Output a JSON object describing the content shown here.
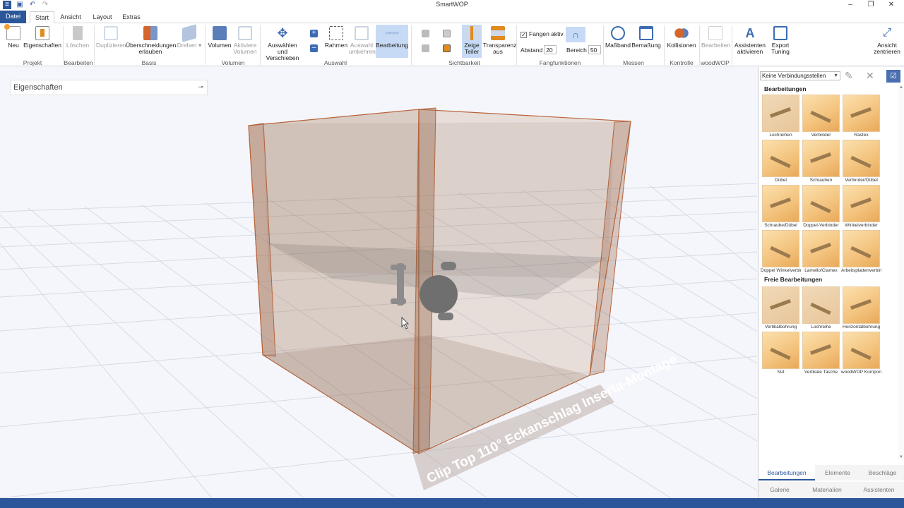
{
  "window": {
    "title": "SmartWOP",
    "controls": [
      "–",
      "❐",
      "✕"
    ]
  },
  "menu": {
    "file": "Datei",
    "tabs": [
      "Start",
      "Ansicht",
      "Layout",
      "Extras"
    ],
    "active_tab": "Start"
  },
  "ribbon": {
    "buttons": {
      "neu": "Neu",
      "eigenschaften": "Eigenschaften",
      "loeschen": "Löschen",
      "duplizieren": "Duplizieren",
      "ueberschneidungen_1": "Überschneidungen",
      "ueberschneidungen_2": "erlauben",
      "drehen": "Drehen ▾",
      "volumen": "Volumen",
      "aktive_volumen_1": "Aktiviere",
      "aktive_volumen_2": "Volumen",
      "auswaehlen_1": "Auswählen und",
      "auswaehlen_2": "Verschieben",
      "rahmen": "Rahmen",
      "umkehren_1": "Auswahl",
      "umkehren_2": "umkehren",
      "bearbeitung": "Bearbeitung",
      "zeige_1": "Zeige",
      "zeige_2": "Teiler",
      "transparenz_1": "Transparenz",
      "transparenz_2": "aus",
      "massband": "Maßband",
      "bemassung": "Bemaßung",
      "kollisionen": "Kollisionen",
      "woodwop_bearbeiten": "Bearbeiten",
      "assistenten_1": "Assistenten",
      "assistenten_2": "aktivieren",
      "export_1": "Export",
      "export_2": "Tuning",
      "ansicht_1": "Ansicht",
      "ansicht_2": "zentrieren"
    },
    "fang": {
      "aktiv_label": "Fangen aktiv",
      "aktiv_checked": "✓",
      "abstand_label": "Abstand",
      "abstand_value": "20",
      "bereich_label": "Bereich",
      "bereich_value": "50"
    },
    "groups": {
      "projekt": "Projekt",
      "bearbeiten": "Bearbeiten",
      "basis": "Basis",
      "volumen": "Volumen",
      "auswahl": "Auswahl",
      "sichtbarkeit": "Sichtbarkeit",
      "fangfunktionen": "Fangfunktionen",
      "messen": "Messen",
      "kontrolle": "Kontrolle",
      "woodwop": "woodWOP"
    }
  },
  "properties_panel": {
    "title": "Eigenschaften",
    "pin_icon": "⊸"
  },
  "scene": {
    "label": "Clip Top 110° Eckanschlag Inserta-Montage"
  },
  "right_panel": {
    "connection_select": "Keine Verbindungsstellen",
    "section_bearbeitungen": "Bearbeitungen",
    "section_freie": "Freie Bearbeitungen",
    "tiles": [
      {
        "label": "Lochreihen"
      },
      {
        "label": "Verbinder"
      },
      {
        "label": "Rastex"
      },
      {
        "label": "Dübel"
      },
      {
        "label": "Schrauben"
      },
      {
        "label": "Verbinder/Dübel"
      },
      {
        "label": "Schraube/Dübel"
      },
      {
        "label": "Doppel-Verbinder"
      },
      {
        "label": "Winkelverbinder"
      },
      {
        "label": "Doppel Winkelverbin..."
      },
      {
        "label": "Lamello/Clamex"
      },
      {
        "label": "Arbeitsplattenverbin..."
      }
    ],
    "free_tiles": [
      {
        "label": "Vertikalbohrung"
      },
      {
        "label": "Lochreihe"
      },
      {
        "label": "Horizontalbohrung"
      },
      {
        "label": "Nut"
      },
      {
        "label": "Vertikale Tasche"
      },
      {
        "label": "woodWOP Kompon..."
      }
    ],
    "bottom_tabs_1": [
      "Bearbeitungen",
      "Elemente",
      "Beschläge"
    ],
    "bottom_tabs_2": [
      "Galerie",
      "Materialien",
      "Assistenten"
    ],
    "active_bottom_tab": "Bearbeitungen"
  },
  "colors": {
    "accent": "#2b579a",
    "selected": "#c7daf5",
    "tile": "#f3c27c",
    "cabinet_edge": "#b8643a"
  }
}
